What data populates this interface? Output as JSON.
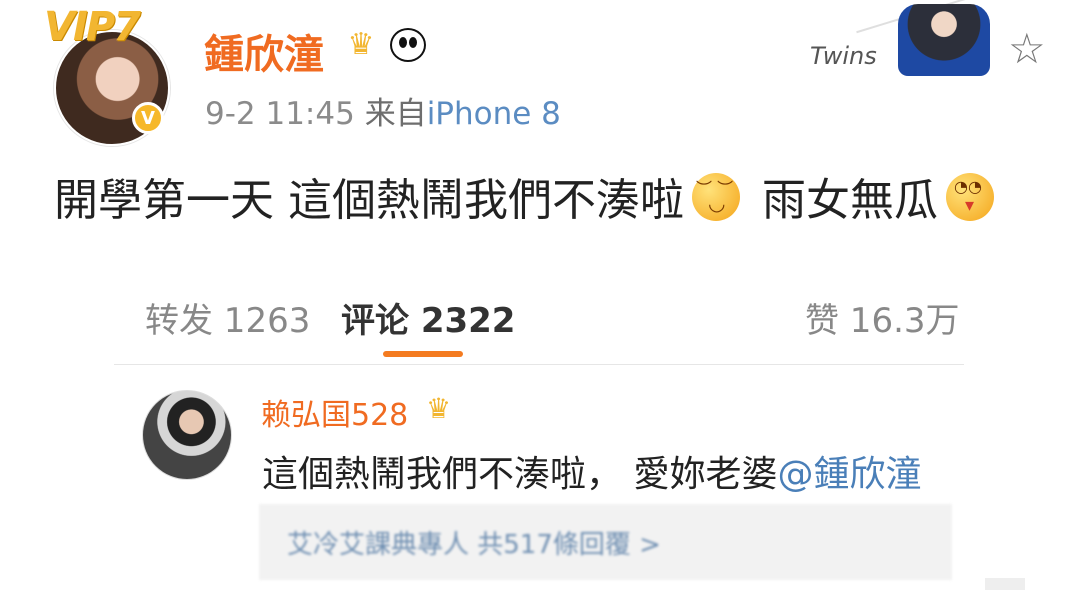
{
  "post": {
    "username": "鍾欣潼",
    "vip_label": "VIP7",
    "verify_label": "V",
    "meta_time": "9-2 11:45",
    "meta_source": "来自",
    "meta_device": "iPhone 8",
    "content_part1": "開學第一天 這個熱鬧我們不湊啦",
    "content_part2": "雨女無瓜"
  },
  "header_deco": {
    "twins_text": "Twins"
  },
  "tabs": {
    "repost_label": "转发 1263",
    "comments_label": "评论 2322",
    "likes_label": "赞 16.3万",
    "accent_color": "#f47b20"
  },
  "comment": {
    "username": "赖弘国528",
    "text_prefix": "這個熱鬧我們不湊啦，  愛妳老婆",
    "mention": "@鍾欣潼",
    "replies_summary": "艾冷艾課典專人 共517條回覆 >"
  },
  "colors": {
    "username": "#f06b21",
    "link": "#4a7fb8",
    "muted": "#8b8b8b"
  }
}
